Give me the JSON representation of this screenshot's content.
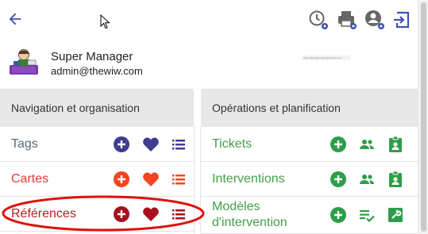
{
  "toolbar": {
    "back_icon": "arrow-left-icon",
    "icons": [
      "clock-settings-icon",
      "printer-settings-icon",
      "account-settings-icon",
      "logout-icon"
    ],
    "accent": "#3f51b5"
  },
  "profile": {
    "name": "Super Manager",
    "email": "admin@thewiw.com",
    "tiny_text": "Super Manager admin@thewiw.com"
  },
  "left_panel": {
    "title": "Navigation et organisation",
    "rows": [
      {
        "label": "Tags",
        "color": "#546e7a",
        "icon_color": "#3f3d8f"
      },
      {
        "label": "Cartes",
        "color": "#e53935",
        "icon_color": "#f4451f"
      },
      {
        "label": "Références",
        "color": "#b71c1c",
        "icon_color": "#a7101e"
      }
    ]
  },
  "right_panel": {
    "title": "Opérations et planification",
    "rows": [
      {
        "label": "Tickets",
        "color": "#43a047"
      },
      {
        "label": "Interventions",
        "color": "#43a047"
      },
      {
        "label_line1": "Modèles",
        "label_line2": "d'intervention",
        "color": "#43a047"
      }
    ]
  },
  "annotation": {
    "color": "#e01010"
  }
}
